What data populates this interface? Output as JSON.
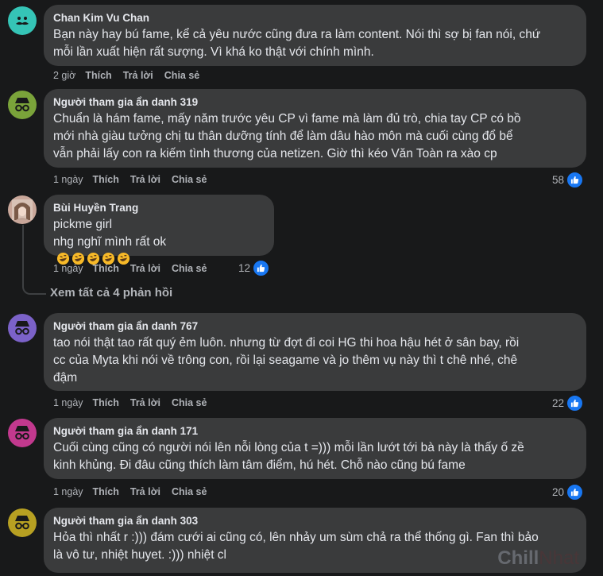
{
  "comments": [
    {
      "author": "Chan Kim Vu Chan",
      "lines": [
        "Bạn này hay bú fame, kể cả yêu nước cũng đưa ra làm content. Nói thì sợ bị fan nói, chứ",
        "mỗi lần xuất hiện rất sượng. Vì khá ko thật với chính mình."
      ],
      "time": "2 giờ",
      "like": "Thích",
      "reply": "Trả lời",
      "share": "Chia sẻ",
      "reactions": "",
      "avatar_color": "#35c4b6"
    },
    {
      "author": "Người tham gia ẩn danh 319",
      "lines": [
        "Chuẩn là hám fame, mấy năm trước yêu CP vì fame mà làm đủ trò, chia tay CP có bồ",
        "mới nhà giàu tưởng chị tu thân dưỡng tính để làm dâu hào môn mà cuối cùng đổ bể",
        "vẫn phải lấy con ra kiếm tình thương của netizen. Giờ thì kéo Văn Toàn ra xào cp"
      ],
      "time": "1 ngày",
      "like": "Thích",
      "reply": "Trả lời",
      "share": "Chia sẻ",
      "reactions": "58",
      "avatar_color": "#7aa33a"
    },
    {
      "author": "Bùi Huyền Trang",
      "lines": [
        "pickme girl",
        "nhg nghĩ mình rất ok"
      ],
      "time": "1 ngày",
      "like": "Thích",
      "reply": "Trả lời",
      "share": "Chia sẻ",
      "reactions": "12",
      "avatar_color": "#c9a79a"
    },
    {
      "author": "Người tham gia ẩn danh 767",
      "lines": [
        "tao nói thật tao rất quý ẻm luôn. nhưng từ đợt đi coi HG thi hoa hậu hét ở sân bay, rồi",
        "cc của Myta khi nói về trông con, rồi lại seagame và jo thêm vụ này thì t chê nhé, chê",
        "đậm"
      ],
      "time": "1 ngày",
      "like": "Thích",
      "reply": "Trả lời",
      "share": "Chia sẻ",
      "reactions": "22",
      "avatar_color": "#7b62c8"
    },
    {
      "author": "Người tham gia ẩn danh 171",
      "lines": [
        "Cuối cùng cũng có người nói lên nỗi lòng của t =))) mỗi lần lướt tới bà này là thấy ố zề",
        "kinh khủng. Đi đâu cũng thích làm tâm điểm, hú hét. Chỗ nào cũng bú fame"
      ],
      "time": "1 ngày",
      "like": "Thích",
      "reply": "Trả lời",
      "share": "Chia sẻ",
      "reactions": "20",
      "avatar_color": "#c2398e"
    },
    {
      "author": "Người tham gia ẩn danh 303",
      "lines": [
        "Hỏa thì nhất r :))) đám cưới ai cũng có, lên nhảy um sùm chả ra thể thống gì. Fan thì bảo",
        "là vô tư, nhiệt huyet. :))) nhiệt cl"
      ],
      "time": "",
      "like": "",
      "reply": "",
      "share": "",
      "reactions": "",
      "avatar_color": "#b7a022"
    }
  ],
  "view_replies": "Xem tất cả 4 phản hồi",
  "watermark": {
    "part1": "Chill",
    "part2": "Nhat"
  },
  "colors": {
    "background": "#18191a",
    "bubble": "#3a3b3c",
    "secondary_text": "#b0b3b8",
    "like_blue": "#1877f2"
  }
}
